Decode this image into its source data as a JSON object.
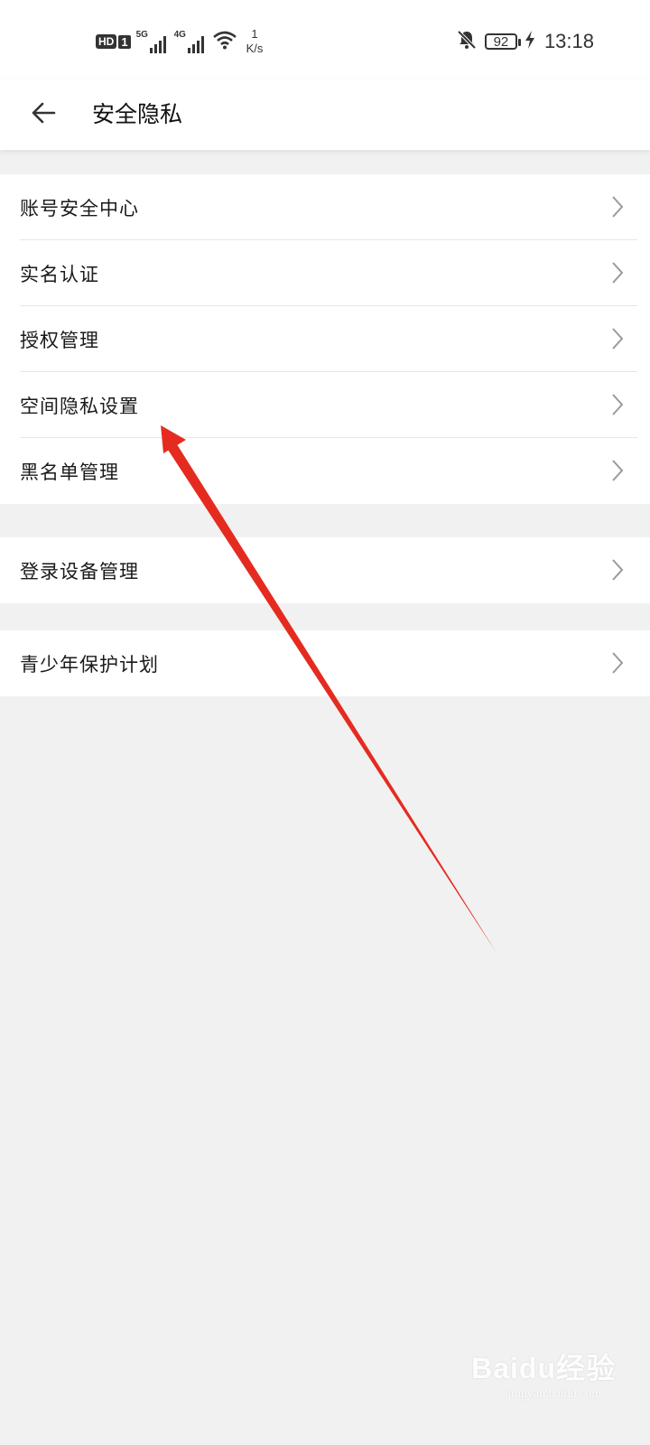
{
  "status_bar": {
    "hd_label": "HD",
    "sim_label": "1",
    "sig1_label": "5G",
    "sig2_label": "4G",
    "net_speed_value": "1",
    "net_speed_unit": "K/s",
    "battery_level": "92",
    "time": "13:18"
  },
  "header": {
    "title": "安全隐私"
  },
  "groups": [
    {
      "items": [
        {
          "label": "账号安全中心"
        },
        {
          "label": "实名认证"
        },
        {
          "label": "授权管理"
        },
        {
          "label": "空间隐私设置"
        },
        {
          "label": "黑名单管理"
        }
      ]
    },
    {
      "items": [
        {
          "label": "登录设备管理"
        }
      ]
    },
    {
      "items": [
        {
          "label": "青少年保护计划"
        }
      ]
    }
  ],
  "watermark": {
    "text": "Baidu经验",
    "url": "jingyan.baidu.com"
  },
  "colors": {
    "annotation_arrow": "#e52b20",
    "background": "#f1f1f1",
    "surface": "#ffffff"
  }
}
